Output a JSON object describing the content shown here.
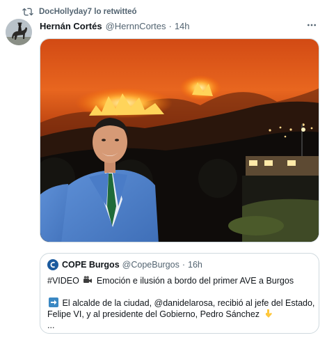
{
  "retweet": {
    "text": "DocHollyday7 lo retwitteó",
    "icon": "retweet-icon"
  },
  "tweet": {
    "author_name": "Hernán Cortés",
    "author_handle": "@HernnCortes",
    "separator": "·",
    "time": "14h",
    "more_icon": "more-options-icon",
    "media_icon": "photo-media"
  },
  "quote": {
    "author_name": "COPE Burgos",
    "author_handle": "@CopeBurgos",
    "separator": "·",
    "time": "16h",
    "line1_a": "#VIDEO",
    "line1_b": "Emoción e ilusión a bordo del primer AVE a Burgos",
    "line2_a": "El alcalde de la ciudad, @danidelarosa, recibió al jefe del Estado,",
    "line3": "Felipe VI, y al presidente del Gobierno, Pedro Sánchez",
    "line4": "...",
    "icons": [
      "video-camera-emoji",
      "right-arrow-emoji",
      "pointing-down-emoji"
    ]
  },
  "colors": {
    "text": "#0f1419",
    "secondary": "#536471",
    "border": "#cfd9de",
    "cope_blue": "#1b5a9e",
    "fire": "#ff7a1a"
  }
}
